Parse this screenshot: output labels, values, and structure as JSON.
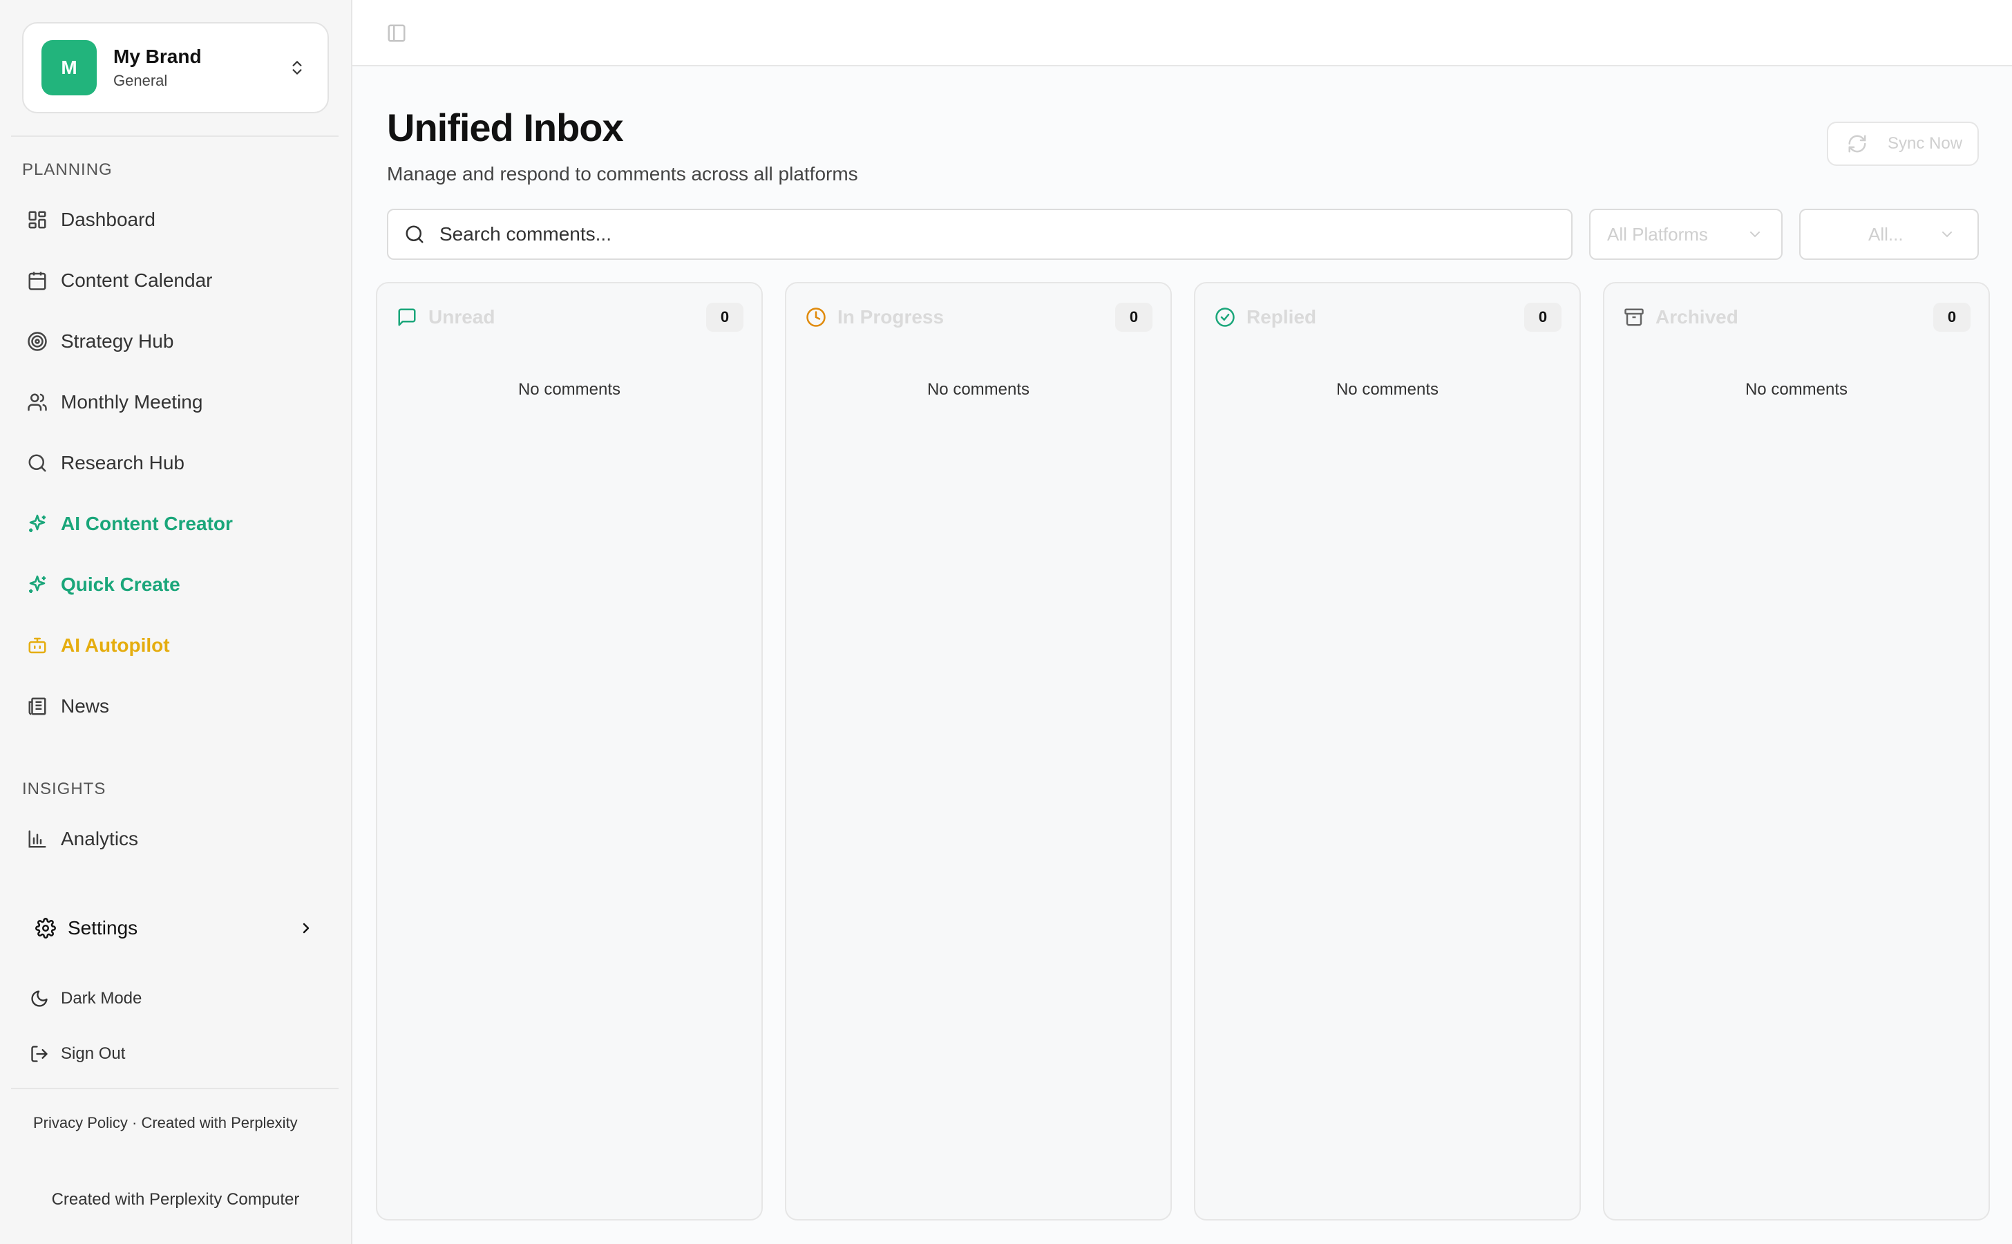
{
  "brand": {
    "initial": "M",
    "name": "My Brand",
    "workspace": "General",
    "color": "#22b47c"
  },
  "sidebar": {
    "planning_label": "PLANNING",
    "insights_label": "INSIGHTS",
    "planning_items": [
      {
        "label": "Dashboard",
        "icon": "dashboard-icon"
      },
      {
        "label": "Content Calendar",
        "icon": "calendar-icon"
      },
      {
        "label": "Strategy Hub",
        "icon": "target-icon"
      },
      {
        "label": "Monthly Meeting",
        "icon": "users-icon"
      },
      {
        "label": "Research Hub",
        "icon": "search-icon"
      },
      {
        "label": "AI Content Creator",
        "icon": "sparkles-icon",
        "accent": "#1aa67a"
      },
      {
        "label": "Quick Create",
        "icon": "sparkles-icon",
        "accent": "#1aa67a"
      },
      {
        "label": "AI Autopilot",
        "icon": "bot-icon",
        "accent": "#e5ad0f"
      },
      {
        "label": "News",
        "icon": "newspaper-icon"
      }
    ],
    "insights_items": [
      {
        "label": "Analytics",
        "icon": "bar-chart-icon"
      }
    ],
    "settings_label": "Settings",
    "dark_mode_label": "Dark Mode",
    "sign_out_label": "Sign Out",
    "footer_links": "Privacy Policy · Created with Perplexity",
    "footer_created": "Created with Perplexity Computer"
  },
  "main": {
    "title": "Unified Inbox",
    "subtitle": "Manage and respond to comments across all platforms",
    "sync_label": "Sync Now",
    "search_placeholder": "Search comments...",
    "platform_filter": "All Platforms",
    "status_filter": "All...",
    "columns": [
      {
        "title": "Unread",
        "count": "0",
        "empty": "No comments",
        "icon": "message-square-icon",
        "icon_color": "#1aa67a"
      },
      {
        "title": "In Progress",
        "count": "0",
        "empty": "No comments",
        "icon": "clock-icon",
        "icon_color": "#e08a0b"
      },
      {
        "title": "Replied",
        "count": "0",
        "empty": "No comments",
        "icon": "check-circle-icon",
        "icon_color": "#1aa67a"
      },
      {
        "title": "Archived",
        "count": "0",
        "empty": "No comments",
        "icon": "archive-icon",
        "icon_color": "#666666"
      }
    ]
  }
}
